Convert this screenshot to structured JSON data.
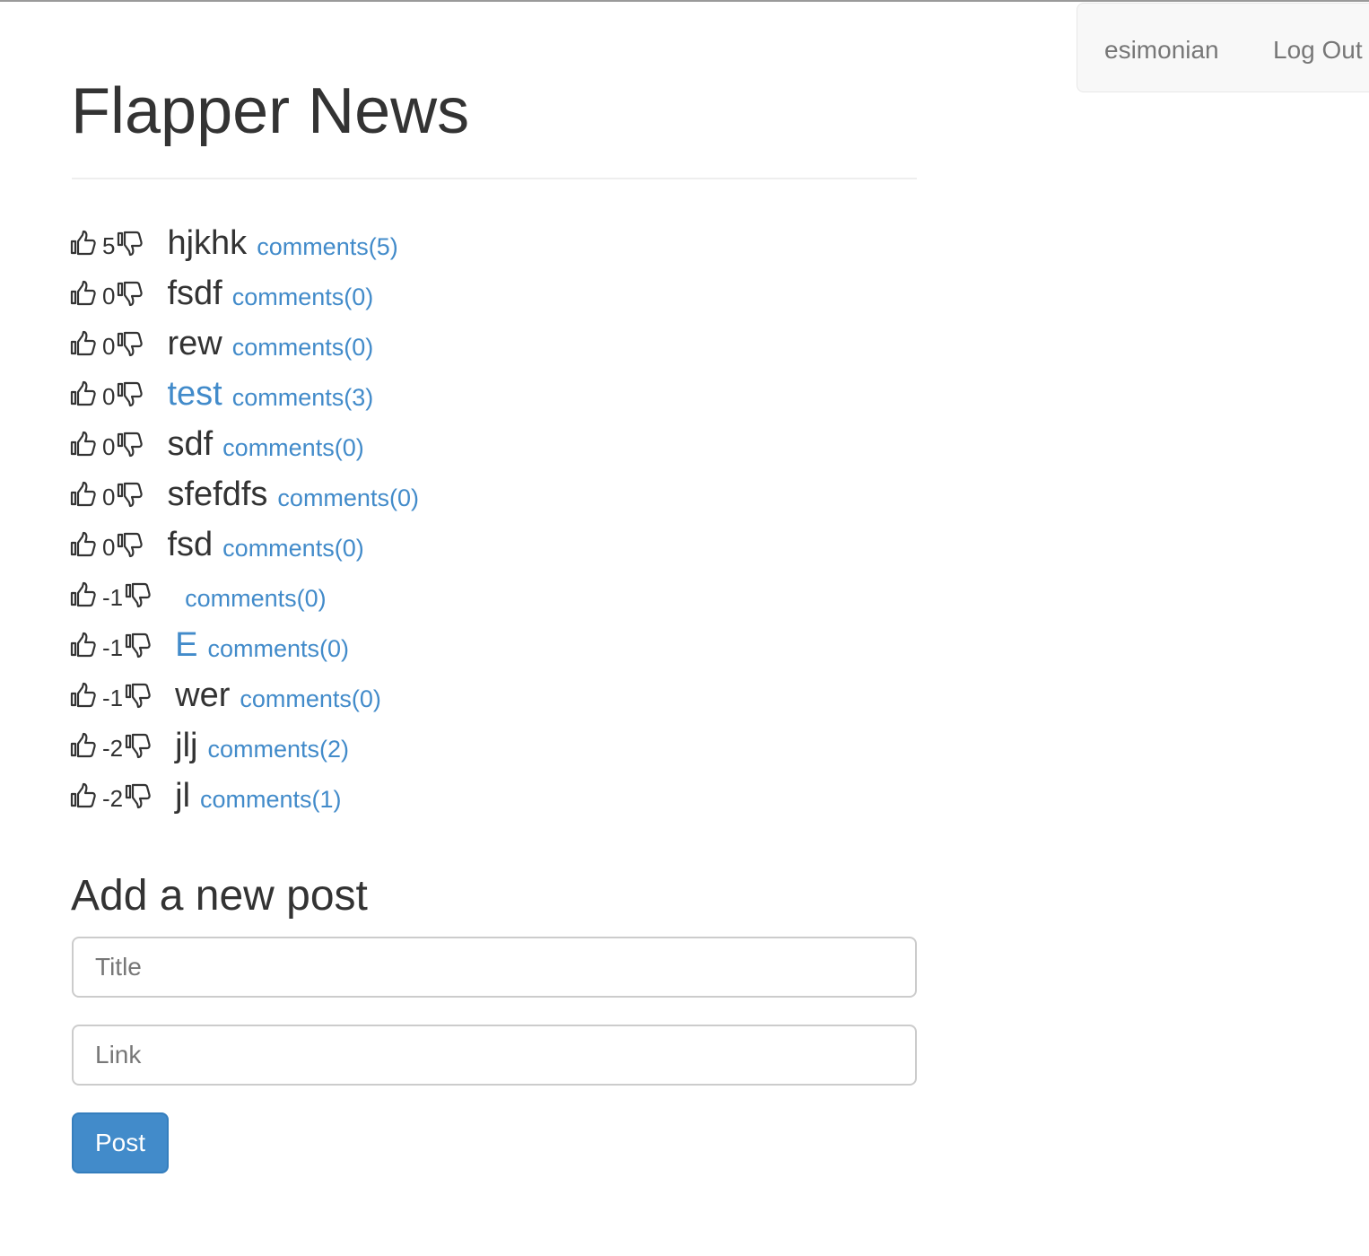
{
  "app": {
    "title": "Flapper News"
  },
  "navbar": {
    "username": "esimonian",
    "logout_label": "Log Out"
  },
  "icons": {
    "upvote": "thumbs-up-icon",
    "downvote": "thumbs-down-icon"
  },
  "colors": {
    "link": "#428bca",
    "text": "#333333",
    "button": "#428bca"
  },
  "posts": [
    {
      "votes": "5",
      "title": "hjkhk",
      "comments": "comments(5)",
      "is_link": false
    },
    {
      "votes": "0",
      "title": "fsdf",
      "comments": "comments(0)",
      "is_link": false
    },
    {
      "votes": "0",
      "title": "rew",
      "comments": "comments(0)",
      "is_link": false
    },
    {
      "votes": "0",
      "title": "test",
      "comments": "comments(3)",
      "is_link": true
    },
    {
      "votes": "0",
      "title": "sdf",
      "comments": "comments(0)",
      "is_link": false
    },
    {
      "votes": "0",
      "title": "sfefdfs",
      "comments": "comments(0)",
      "is_link": false
    },
    {
      "votes": "0",
      "title": "fsd",
      "comments": "comments(0)",
      "is_link": false
    },
    {
      "votes": "-1",
      "title": "",
      "comments": "comments(0)",
      "is_link": false
    },
    {
      "votes": "-1",
      "title": "E",
      "comments": "comments(0)",
      "is_link": true
    },
    {
      "votes": "-1",
      "title": "wer",
      "comments": "comments(0)",
      "is_link": false
    },
    {
      "votes": "-2",
      "title": "jlj",
      "comments": "comments(2)",
      "is_link": false
    },
    {
      "votes": "-2",
      "title": "jl",
      "comments": "comments(1)",
      "is_link": false
    }
  ],
  "new_post_form": {
    "heading": "Add a new post",
    "title_placeholder": "Title",
    "title_value": "",
    "link_placeholder": "Link",
    "link_value": "",
    "submit_label": "Post"
  }
}
